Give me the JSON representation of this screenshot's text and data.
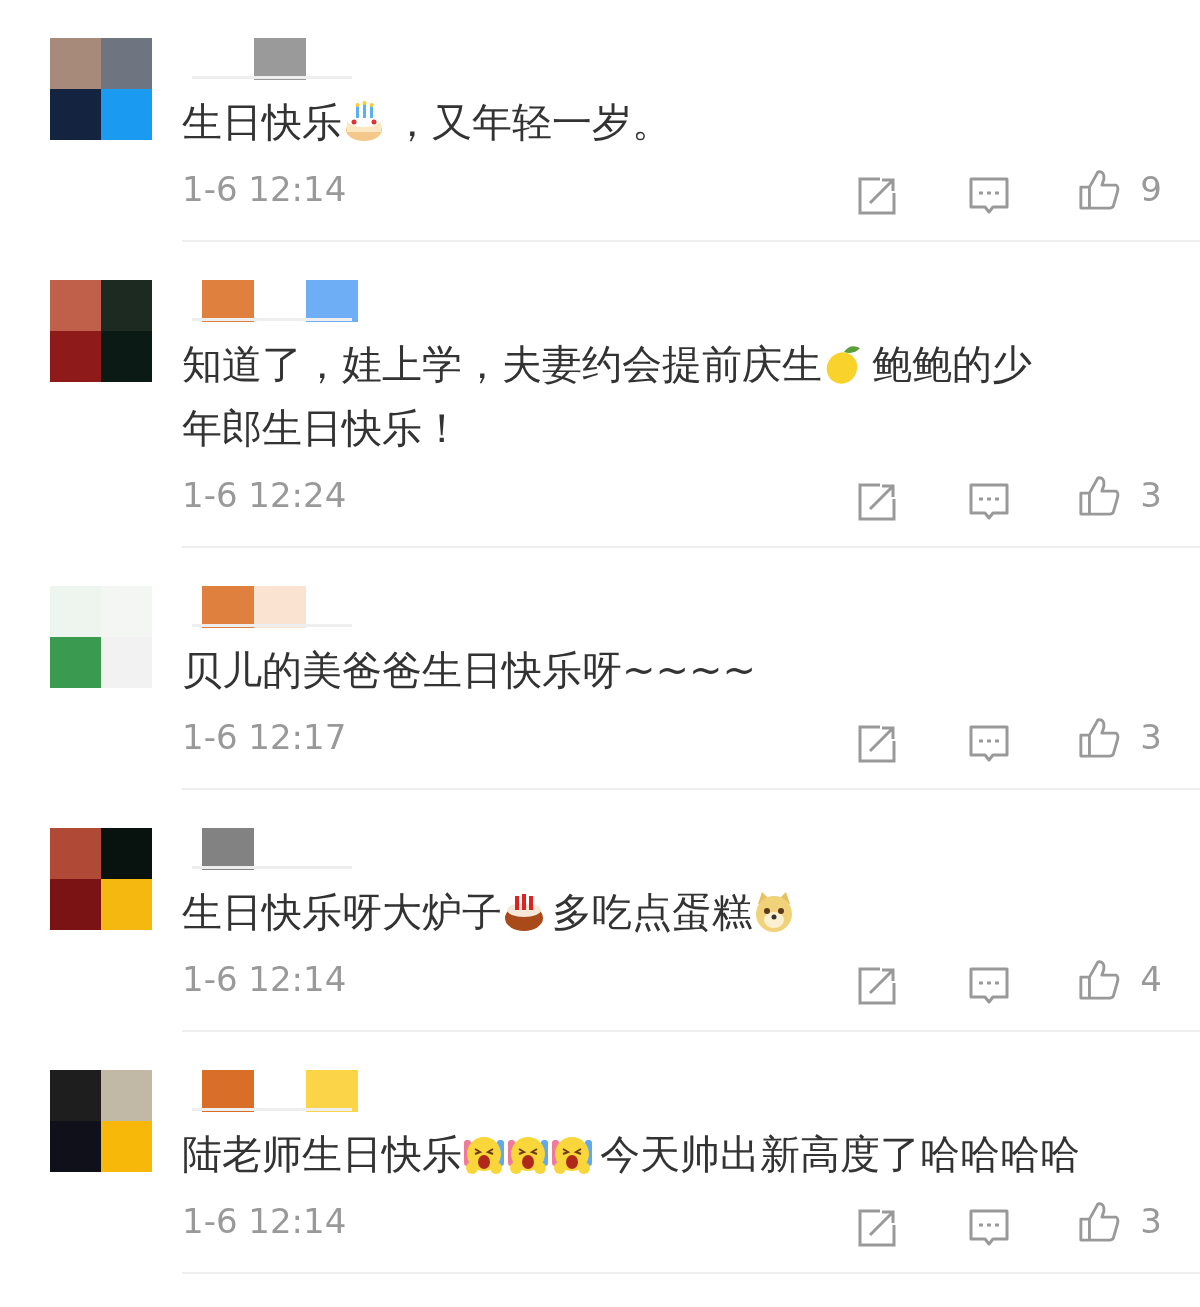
{
  "comments": [
    {
      "avatar": {
        "kind": "picture"
      },
      "segments": [
        {
          "kind": "text",
          "text": "生日快乐"
        },
        {
          "kind": "cake"
        },
        {
          "kind": "text",
          "text": "，又年轻一岁。"
        }
      ],
      "time": "1-6 12:14",
      "likes": "9"
    },
    {
      "avatar": {
        "kind": "picture"
      },
      "segments": [
        {
          "kind": "text",
          "text": "知道了，娃上学，夫妻约会提前庆生"
        },
        {
          "kind": "lemon"
        },
        {
          "kind": "text",
          "text": "鲍鲍的少"
        },
        {
          "kind": "text",
          "text": "年郎生日快乐！"
        }
      ],
      "time": "1-6 12:24",
      "likes": "3"
    },
    {
      "avatar": {
        "kind": "picture"
      },
      "segments": [
        {
          "kind": "text",
          "text": "贝儿的美爸爸生日快乐呀~~~~"
        }
      ],
      "time": "1-6 12:17",
      "likes": "3"
    },
    {
      "avatar": {
        "kind": "picture"
      },
      "segments": [
        {
          "kind": "text",
          "text": "生日快乐呀大炉子"
        },
        {
          "kind": "candlecake"
        },
        {
          "kind": "text",
          "text": "多吃点蛋糕"
        },
        {
          "kind": "dog"
        }
      ],
      "time": "1-6 12:14",
      "likes": "4"
    },
    {
      "avatar": {
        "kind": "picture"
      },
      "segments": [
        {
          "kind": "text",
          "text": "陆老师生日快乐"
        },
        {
          "kind": "laugh"
        },
        {
          "kind": "laugh"
        },
        {
          "kind": "laugh"
        },
        {
          "kind": "text",
          "text": "今天帅出新高度了哈哈哈哈"
        }
      ],
      "time": "1-6 12:14",
      "likes": "3"
    }
  ]
}
